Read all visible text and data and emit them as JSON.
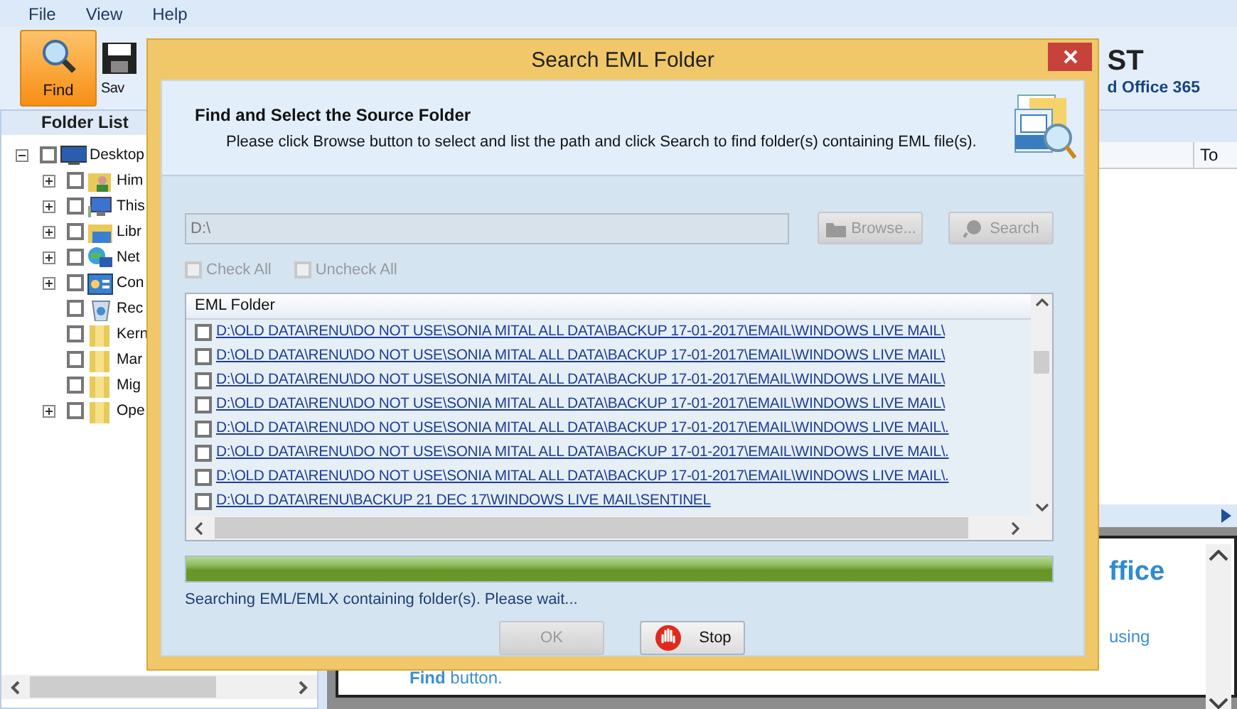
{
  "menu": [
    {
      "label": "File"
    },
    {
      "label": "View"
    },
    {
      "label": "Help"
    }
  ],
  "toolbar": {
    "items": [
      {
        "label": "Find",
        "kind": "find",
        "selected": true
      },
      {
        "label": "Sav",
        "kind": "save",
        "selected": false
      }
    ]
  },
  "brand": {
    "title": "ST",
    "subtitle": "d Office 365"
  },
  "folder_list": {
    "title": "Folder List",
    "items": [
      {
        "label": "Desktop",
        "kind": "desktop",
        "checked": false,
        "expanded": true,
        "children": [
          {
            "label": "Him",
            "kind": "user",
            "checked": false,
            "expanded": false
          },
          {
            "label": "This",
            "kind": "computer",
            "checked": false,
            "expanded": false
          },
          {
            "label": "Libr",
            "kind": "library",
            "checked": false,
            "expanded": false
          },
          {
            "label": "Net",
            "kind": "network",
            "checked": false,
            "expanded": false
          },
          {
            "label": "Con",
            "kind": "control",
            "checked": false,
            "expanded": false
          },
          {
            "label": "Rec",
            "kind": "recycle",
            "checked": false
          },
          {
            "label": "Kern",
            "kind": "folder",
            "checked": false
          },
          {
            "label": "Mar",
            "kind": "folder",
            "checked": false
          },
          {
            "label": "Mig",
            "kind": "folder",
            "checked": false
          },
          {
            "label": "Ope",
            "kind": "folder",
            "checked": false,
            "expanded": false
          }
        ]
      }
    ]
  },
  "table": {
    "columns": [
      "To"
    ]
  },
  "preview": {
    "heading": "ffice",
    "line": "using",
    "note": "**Find** button."
  },
  "dialog": {
    "title": "Search EML Folder",
    "heading": "Find and Select the Source Folder",
    "description": "Please click Browse button to select and list the path and click Search to find folder(s) containing EML file(s).",
    "path": {
      "value": "D:\\",
      "disabled": true
    },
    "browse": {
      "label": "Browse...",
      "disabled": true
    },
    "search": {
      "label": "Search",
      "disabled": true
    },
    "check_all": {
      "label": "Check All",
      "checked": false,
      "disabled": true
    },
    "uncheck_all": {
      "label": "Uncheck All",
      "checked": false,
      "disabled": true
    },
    "list_header": "EML Folder",
    "rows": [
      {
        "path": "D:\\OLD DATA\\RENU\\DO NOT USE\\SONIA MITAL ALL DATA\\BACKUP 17-01-2017\\EMAIL\\WINDOWS LIVE MAIL\\",
        "checked": false
      },
      {
        "path": "D:\\OLD DATA\\RENU\\DO NOT USE\\SONIA MITAL ALL DATA\\BACKUP 17-01-2017\\EMAIL\\WINDOWS LIVE MAIL\\",
        "checked": false
      },
      {
        "path": "D:\\OLD DATA\\RENU\\DO NOT USE\\SONIA MITAL ALL DATA\\BACKUP 17-01-2017\\EMAIL\\WINDOWS LIVE MAIL\\",
        "checked": false
      },
      {
        "path": "D:\\OLD DATA\\RENU\\DO NOT USE\\SONIA MITAL ALL DATA\\BACKUP 17-01-2017\\EMAIL\\WINDOWS LIVE MAIL\\",
        "checked": false
      },
      {
        "path": "D:\\OLD DATA\\RENU\\DO NOT USE\\SONIA MITAL ALL DATA\\BACKUP 17-01-2017\\EMAIL\\WINDOWS LIVE MAIL\\.",
        "checked": false
      },
      {
        "path": "D:\\OLD DATA\\RENU\\DO NOT USE\\SONIA MITAL ALL DATA\\BACKUP 17-01-2017\\EMAIL\\WINDOWS LIVE MAIL\\.",
        "checked": false
      },
      {
        "path": "D:\\OLD DATA\\RENU\\DO NOT USE\\SONIA MITAL ALL DATA\\BACKUP 17-01-2017\\EMAIL\\WINDOWS LIVE MAIL\\.",
        "checked": false
      },
      {
        "path": "D:\\OLD DATA\\RENU\\BACKUP 21 DEC 17\\WINDOWS LIVE MAIL\\SENTINEL",
        "checked": false
      }
    ],
    "progress": {
      "level": 1
    },
    "status": "Searching EML/EMLX containing folder(s). Please wait...",
    "ok": {
      "label": "OK",
      "disabled": true
    },
    "stop": {
      "label": "Stop",
      "disabled": false
    }
  }
}
